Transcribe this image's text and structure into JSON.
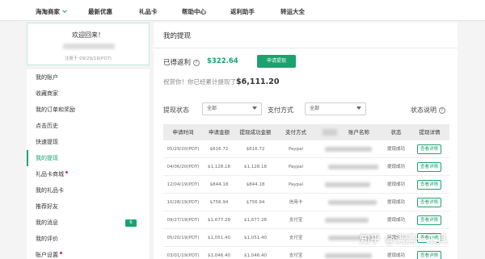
{
  "nav": {
    "items": [
      "海淘商家",
      "最新优惠",
      "礼品卡",
      "帮助中心",
      "返利助手",
      "转运大全"
    ]
  },
  "welcome": {
    "title": "欢迎回来！",
    "registered": "注册于 09/29/18(PDT)"
  },
  "sidebar": {
    "items": [
      {
        "label": "我的账户"
      },
      {
        "label": "收藏商家"
      },
      {
        "label": "我的订单和奖励"
      },
      {
        "label": "点击历史"
      },
      {
        "label": "快速提现"
      },
      {
        "label": "我的提现",
        "active": true
      },
      {
        "label": "礼品卡商城",
        "dot": true
      },
      {
        "label": "我的礼品卡"
      },
      {
        "label": "推荐好友"
      },
      {
        "label": "我的消息",
        "badge": "6"
      },
      {
        "label": "我的评价"
      },
      {
        "label": "账户设置",
        "dot": true
      }
    ]
  },
  "main": {
    "title": "我的提现",
    "rebate_label": "已得返利",
    "rebate_value": "$322.64",
    "withdraw_button": "申请提现",
    "congrats_text": "祝贺你！你已经累计提现了",
    "congrats_amount": "$6,111.20",
    "filter_status_label": "提现状态",
    "filter_status_value": "全部",
    "filter_method_label": "支付方式",
    "filter_method_value": "全部",
    "status_help_label": "状态说明"
  },
  "table": {
    "headers": [
      "申请时间",
      "申请金额",
      "提现成功金额",
      "支付方式",
      "账户名称",
      "状态",
      "提现详情"
    ],
    "detail_label": "查看详情",
    "rows": [
      {
        "date": "05/29/20(PDT)",
        "amount": "$616.72",
        "success": "$616.72",
        "method": "Paypal",
        "status": "提现成功"
      },
      {
        "date": "04/06/20(PDT)",
        "amount": "$1,128.18",
        "success": "$1,128.18",
        "method": "Paypal",
        "status": "提现成功"
      },
      {
        "date": "12/04/19(PDT)",
        "amount": "$844.18",
        "success": "$844.18",
        "method": "Paypal",
        "status": "提现成功"
      },
      {
        "date": "10/28/19(PDT)",
        "amount": "$756.94",
        "success": "$756.94",
        "method": "信用卡",
        "status": "提现成功"
      },
      {
        "date": "09/27/19(PDT)",
        "amount": "$1,677.28",
        "success": "$1,677.28",
        "method": "支付宝",
        "status": "提现成功"
      },
      {
        "date": "05/20/19(PDT)",
        "amount": "$1,051.40",
        "success": "$1,051.40",
        "method": "支付宝",
        "status": "提现成功"
      },
      {
        "date": "03/01/19(PDT)",
        "amount": "$1,046.40",
        "success": "$1,046.40",
        "method": "支付宝",
        "status": "提现成功"
      }
    ]
  },
  "watermark": "知乎 @满满一工具",
  "colors": {
    "accent": "#1aa36f",
    "badge_dot": "#e0245e"
  }
}
